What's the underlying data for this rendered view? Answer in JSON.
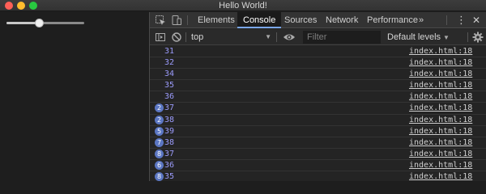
{
  "window": {
    "title": "Hello World!"
  },
  "app": {
    "slider": {
      "value_fraction": 0.42
    }
  },
  "devtools": {
    "tabs": [
      {
        "label": "Elements",
        "active": false
      },
      {
        "label": "Console",
        "active": true
      },
      {
        "label": "Sources",
        "active": false
      },
      {
        "label": "Network",
        "active": false
      },
      {
        "label": "Performance",
        "active": false
      }
    ],
    "more_tabs": "»",
    "toolbar": {
      "context": "top",
      "filter_placeholder": "Filter",
      "levels": "Default levels"
    },
    "console_rows": [
      {
        "count": "",
        "value": "31",
        "source": "index.html:18"
      },
      {
        "count": "",
        "value": "32",
        "source": "index.html:18"
      },
      {
        "count": "",
        "value": "34",
        "source": "index.html:18"
      },
      {
        "count": "",
        "value": "35",
        "source": "index.html:18"
      },
      {
        "count": "",
        "value": "36",
        "source": "index.html:18"
      },
      {
        "count": "2",
        "value": "37",
        "source": "index.html:18"
      },
      {
        "count": "2",
        "value": "38",
        "source": "index.html:18"
      },
      {
        "count": "5",
        "value": "39",
        "source": "index.html:18"
      },
      {
        "count": "7",
        "value": "38",
        "source": "index.html:18"
      },
      {
        "count": "8",
        "value": "37",
        "source": "index.html:18"
      },
      {
        "count": "6",
        "value": "36",
        "source": "index.html:18"
      },
      {
        "count": "8",
        "value": "35",
        "source": "index.html:18"
      }
    ],
    "colors": {
      "accent": "#7aa7e9",
      "badge": "#5b76c2",
      "value": "#9b9bfb"
    }
  }
}
